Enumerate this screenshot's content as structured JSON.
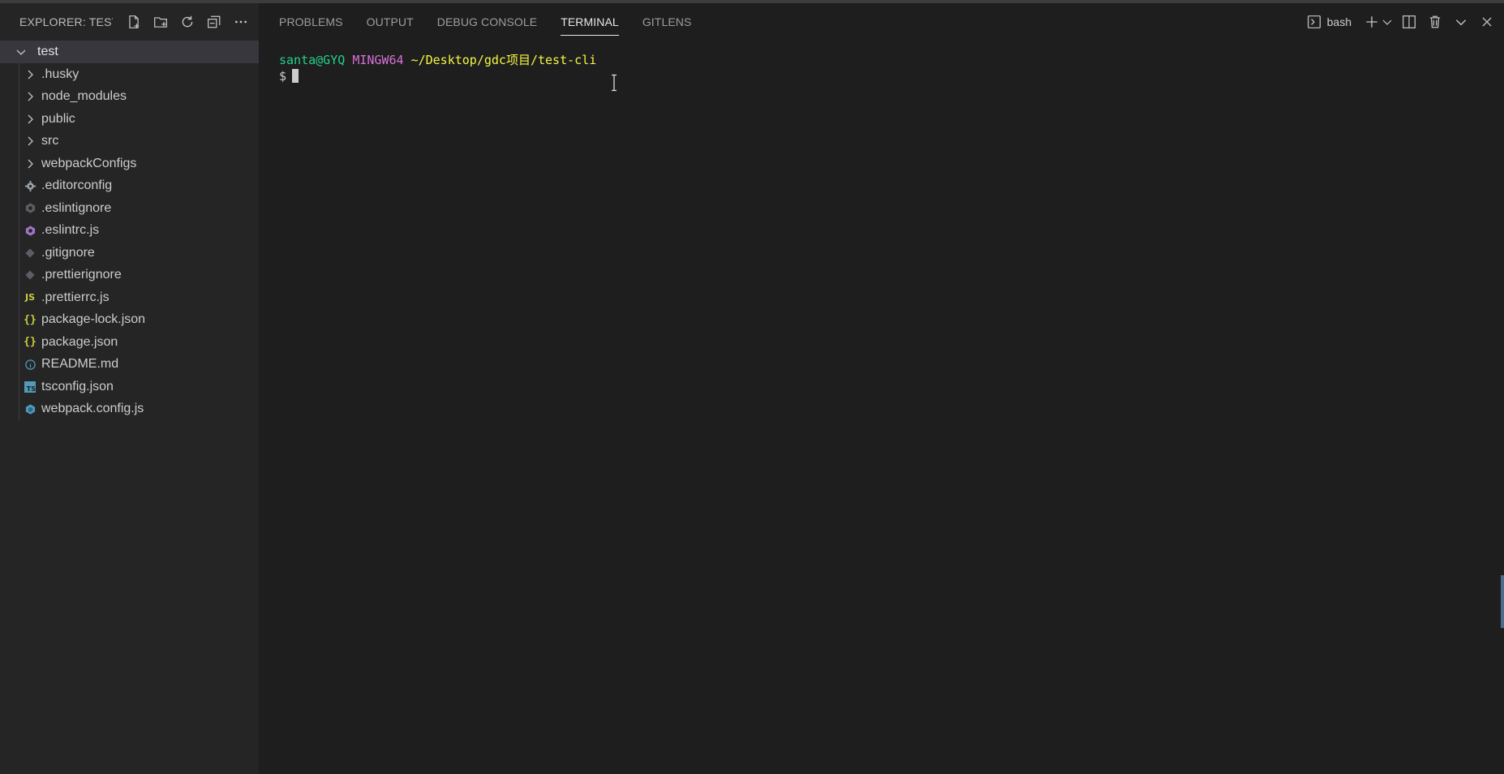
{
  "sidebar": {
    "title": "EXPLORER: TEST-...",
    "actions": [
      {
        "name": "new-file-icon"
      },
      {
        "name": "new-folder-icon"
      },
      {
        "name": "refresh-icon"
      },
      {
        "name": "collapse-all-icon"
      },
      {
        "name": "more-actions-icon"
      }
    ],
    "root": {
      "label": "test",
      "icon": "chevron-down-icon"
    },
    "items": [
      {
        "label": ".husky",
        "icon": "chevron-right-icon",
        "type": "folder"
      },
      {
        "label": "node_modules",
        "icon": "chevron-right-icon",
        "type": "folder"
      },
      {
        "label": "public",
        "icon": "chevron-right-icon",
        "type": "folder"
      },
      {
        "label": "src",
        "icon": "chevron-right-icon",
        "type": "folder"
      },
      {
        "label": "webpackConfigs",
        "icon": "chevron-right-icon",
        "type": "folder"
      },
      {
        "label": ".editorconfig",
        "icon": "gear-icon",
        "type": "file",
        "color": "#9ca3af"
      },
      {
        "label": ".eslintignore",
        "icon": "eslint-icon",
        "type": "file",
        "color": "#6b7280"
      },
      {
        "label": ".eslintrc.js",
        "icon": "eslint-icon",
        "type": "file",
        "color": "#a074c4"
      },
      {
        "label": ".gitignore",
        "icon": "git-icon",
        "type": "file",
        "color": "#6b7280"
      },
      {
        "label": ".prettierignore",
        "icon": "prettier-icon",
        "type": "file",
        "color": "#6b7280"
      },
      {
        "label": ".prettierrc.js",
        "icon": "javascript-icon",
        "type": "file",
        "color": "#cbcb41",
        "glyph": "JS"
      },
      {
        "label": "package-lock.json",
        "icon": "json-icon",
        "type": "file",
        "color": "#cbcb41",
        "glyph": "{}"
      },
      {
        "label": "package.json",
        "icon": "json-icon",
        "type": "file",
        "color": "#cbcb41",
        "glyph": "{}"
      },
      {
        "label": "README.md",
        "icon": "info-icon",
        "type": "file",
        "color": "#519aba"
      },
      {
        "label": "tsconfig.json",
        "icon": "typescript-icon",
        "type": "file",
        "color": "#519aba",
        "glyph": "TS"
      },
      {
        "label": "webpack.config.js",
        "icon": "webpack-icon",
        "type": "file",
        "color": "#519aba"
      }
    ]
  },
  "panel": {
    "tabs": [
      {
        "label": "PROBLEMS",
        "active": false
      },
      {
        "label": "OUTPUT",
        "active": false
      },
      {
        "label": "DEBUG CONSOLE",
        "active": false
      },
      {
        "label": "TERMINAL",
        "active": true
      },
      {
        "label": "GITLENS",
        "active": false
      }
    ],
    "terminal_selector": {
      "label": "bash",
      "icon": "terminal-icon"
    },
    "actions": [
      {
        "name": "new-terminal-icon"
      },
      {
        "name": "terminal-dropdown-chevron-icon"
      },
      {
        "name": "split-terminal-icon"
      },
      {
        "name": "kill-terminal-trash-icon"
      },
      {
        "name": "maximize-panel-chevron-icon"
      },
      {
        "name": "close-panel-icon"
      }
    ]
  },
  "terminal": {
    "user_host": "santa@GYQ",
    "system": "MINGW64",
    "path": "~/Desktop/gdc项目/test-cli",
    "prompt": "$",
    "colors": {
      "user_host": "#23d18b",
      "system": "#d670d6",
      "path": "#f5f543"
    }
  }
}
